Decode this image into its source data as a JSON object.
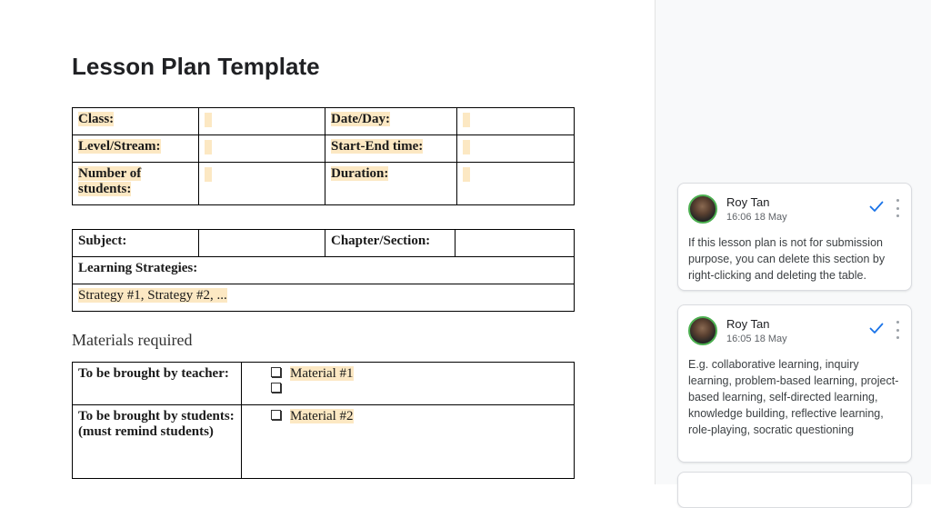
{
  "document": {
    "title": "Lesson Plan Template",
    "info_table": {
      "class_label": "Class:",
      "date_label": "Date/Day:",
      "level_label": "Level/Stream:",
      "time_label": "Start-End time:",
      "students_label": "Number of students:",
      "duration_label": "Duration:"
    },
    "subject_table": {
      "subject_label": "Subject:",
      "chapter_label": "Chapter/Section:",
      "strategies_label": "Learning Strategies:",
      "strategies_value": "Strategy #1, Strategy #2, ..."
    },
    "materials_heading": "Materials required",
    "materials_table": {
      "teacher_label": "To be brought by teacher:",
      "teacher_items": [
        "Material #1",
        ""
      ],
      "students_label": "To be brought by students:",
      "students_note": "(must remind students)",
      "students_items": [
        "Material #2"
      ]
    }
  },
  "comments": [
    {
      "author": "Roy Tan",
      "timestamp": "16:06 18 May",
      "text": "If this lesson plan is not for submission purpose, you can delete this section by right-clicking and deleting the table."
    },
    {
      "author": "Roy Tan",
      "timestamp": "16:05 18 May",
      "text": "E.g. collaborative learning, inquiry learning, problem-based learning, project-based learning, self-directed learning, knowledge building, reflective learning, role-playing, socratic questioning"
    }
  ],
  "colors": {
    "highlight": "#fce8c3",
    "resolve_check": "#1a73e8",
    "avatar_ring": "#4caf50"
  },
  "icons": {
    "resolve": "check-icon",
    "more": "more-vert-icon",
    "avatar": "avatar"
  }
}
